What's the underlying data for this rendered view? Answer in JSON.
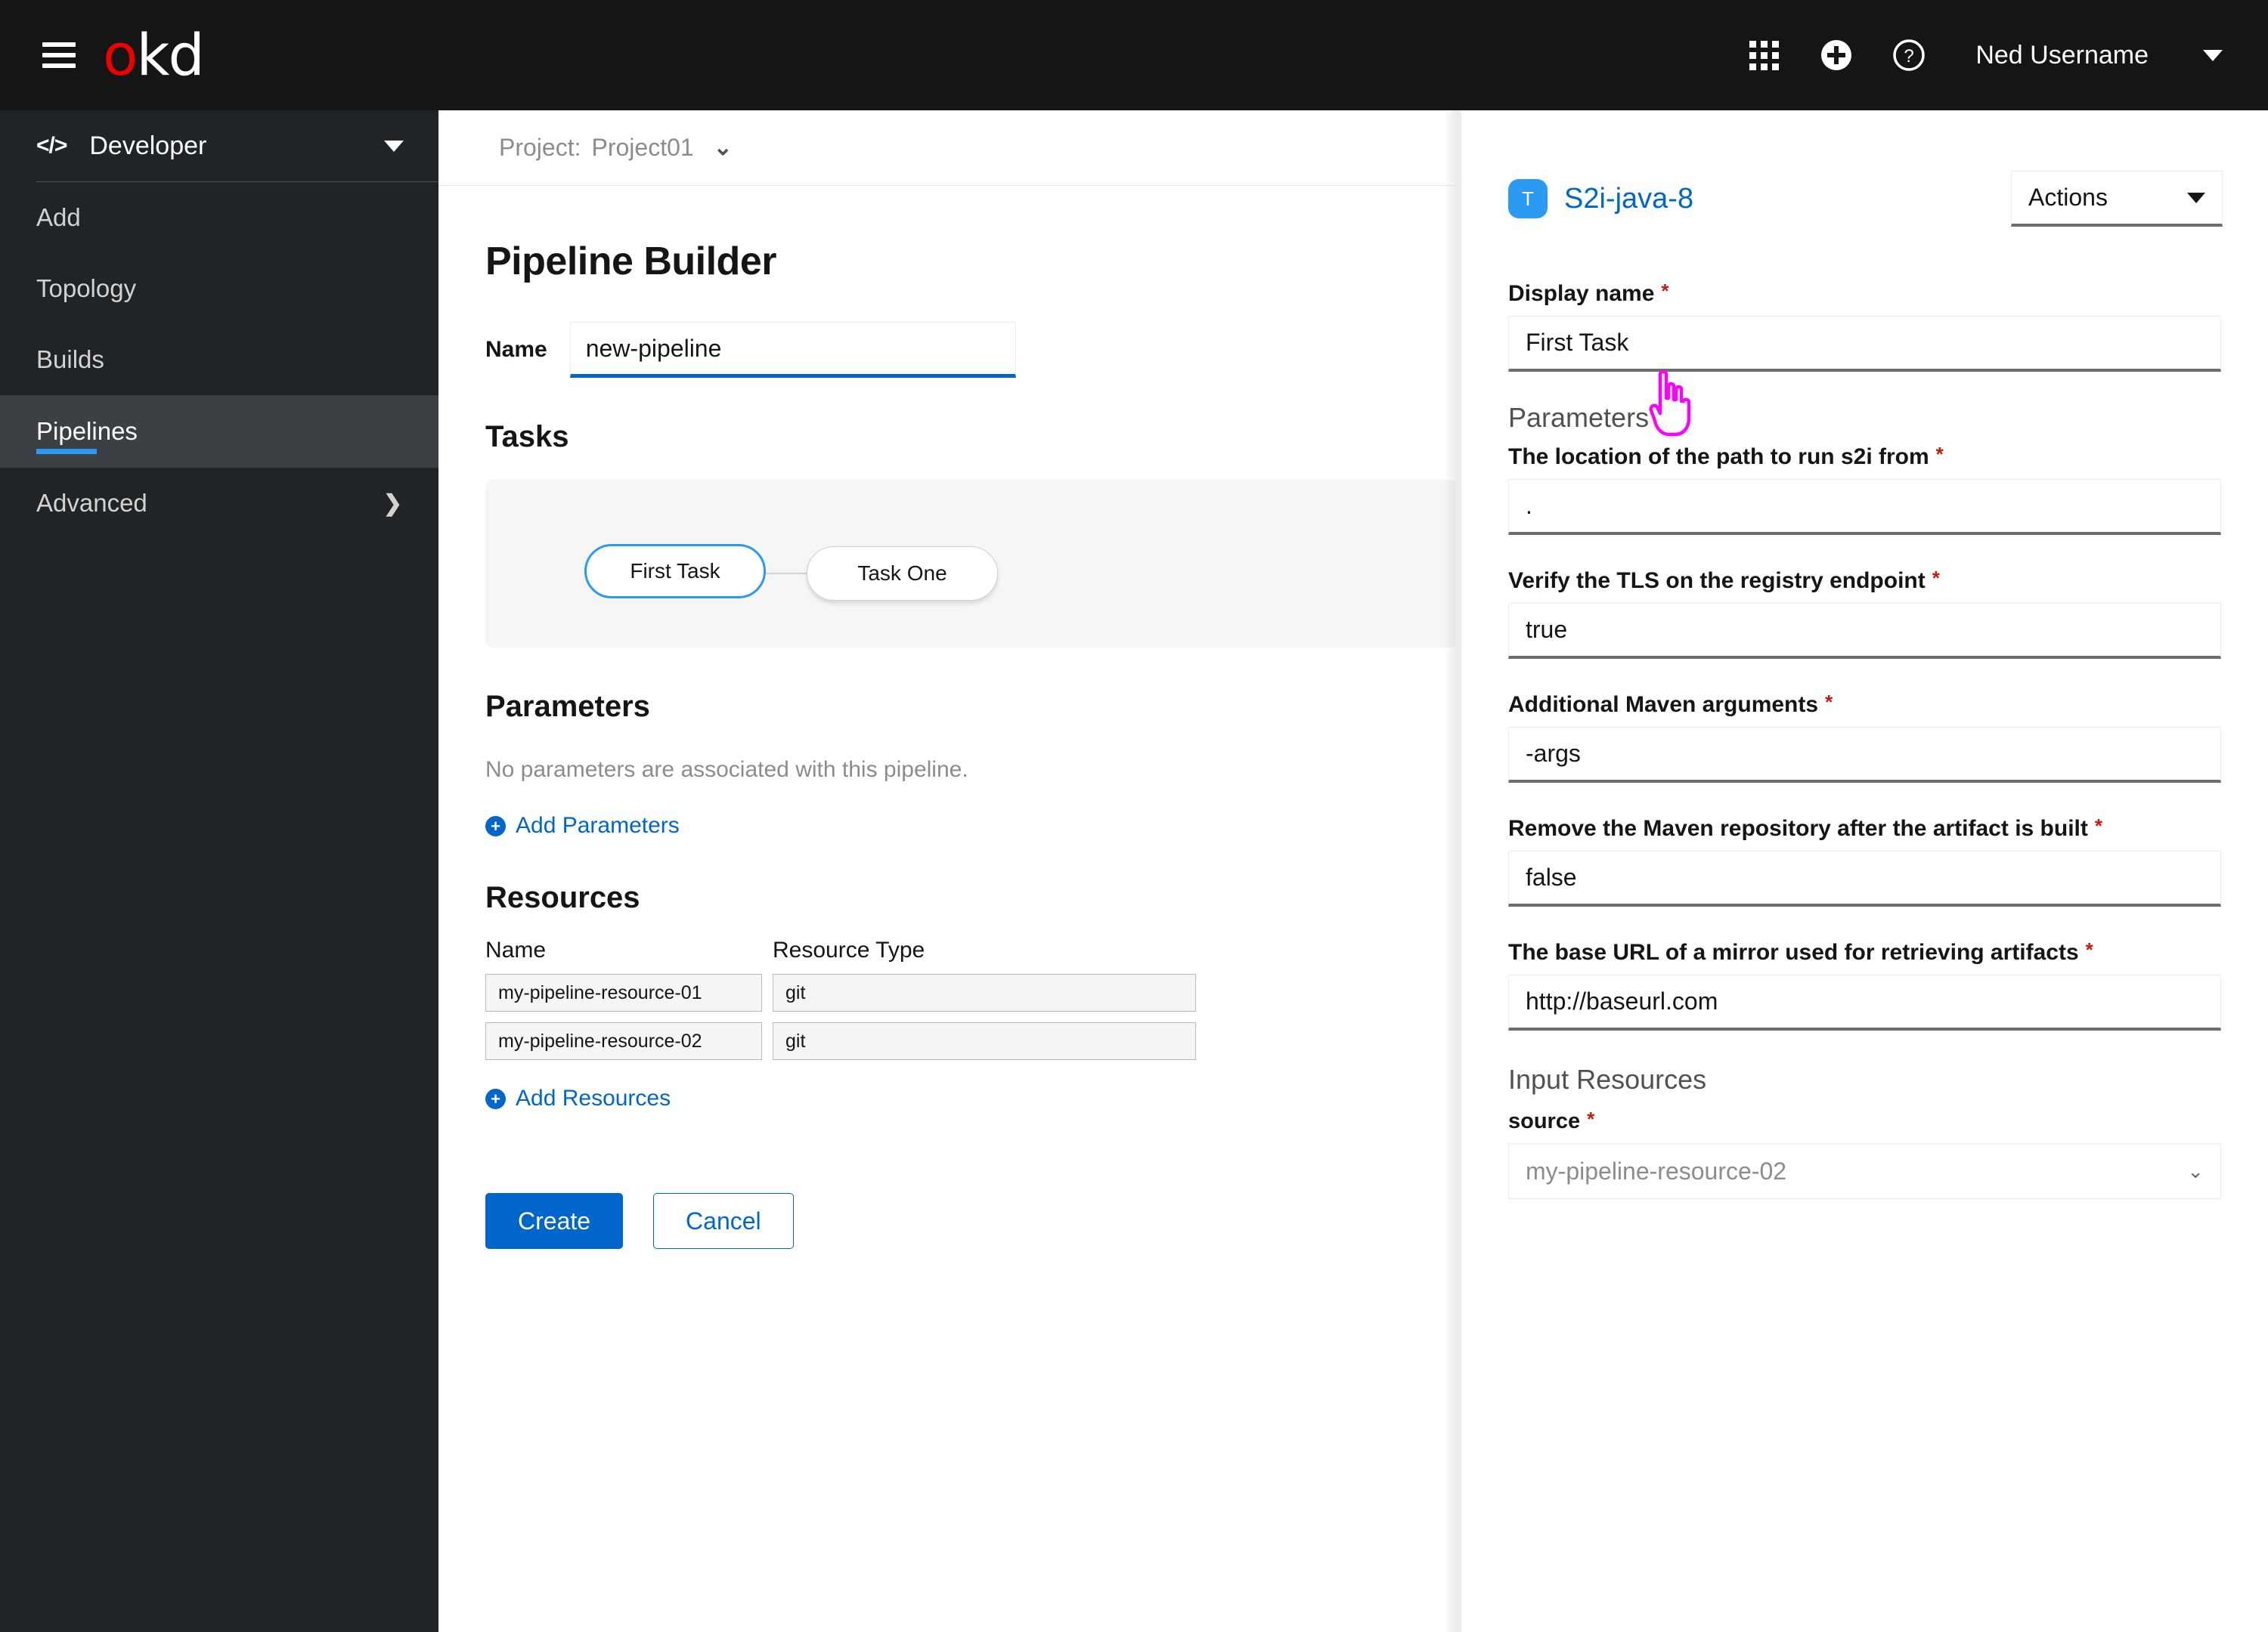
{
  "masthead": {
    "logo_o": "o",
    "logo_kd": "kd",
    "hamburger_icon": "hamburger-menu-icon",
    "apps_icon": "grid-apps-icon",
    "add_icon": "plus-circle-icon",
    "help_icon": "question-circle-icon",
    "username": "Ned Username",
    "user_caret_icon": "caret-down-icon"
  },
  "sidebar": {
    "perspective": {
      "label": "Developer",
      "icon": "code-brackets-icon",
      "caret": "caret-down-icon"
    },
    "items": [
      {
        "label": "Add",
        "active": false
      },
      {
        "label": "Topology",
        "active": false
      },
      {
        "label": "Builds",
        "active": false
      },
      {
        "label": "Pipelines",
        "active": true
      },
      {
        "label": "Advanced",
        "active": false,
        "chevron": "chevron-right-icon"
      }
    ]
  },
  "main": {
    "project_bar": {
      "label": "Project:",
      "value": "Project01",
      "chevron": "chevron-down-icon"
    },
    "page_title": "Pipeline Builder",
    "name_field": {
      "label": "Name",
      "value": "new-pipeline"
    },
    "tasks": {
      "heading": "Tasks",
      "nodes": [
        {
          "label": "First Task",
          "selected": true
        },
        {
          "label": "Task One",
          "selected": false
        }
      ]
    },
    "parameters": {
      "heading": "Parameters",
      "empty_text": "No parameters are associated with this pipeline.",
      "add_link": "Add Parameters"
    },
    "resources": {
      "heading": "Resources",
      "columns": [
        "Name",
        "Resource Type"
      ],
      "rows": [
        {
          "name": "my-pipeline-resource-01",
          "type": "git"
        },
        {
          "name": "my-pipeline-resource-02",
          "type": "git"
        }
      ],
      "add_link": "Add Resources"
    },
    "buttons": {
      "create": "Create",
      "cancel": "Cancel"
    }
  },
  "panel": {
    "badge": "T",
    "title": "S2i-java-8",
    "actions": {
      "label": "Actions",
      "caret": "caret-down-icon"
    },
    "display_name": {
      "label": "Display name",
      "value": "First Task",
      "required": "*"
    },
    "parameters_heading": "Parameters",
    "parameters": [
      {
        "label": "The location of the path to run s2i from",
        "value": ".",
        "required": "*"
      },
      {
        "label": "Verify the TLS on the registry endpoint",
        "value": "true",
        "required": "*"
      },
      {
        "label": "Additional Maven arguments",
        "value": "-args",
        "required": "*"
      },
      {
        "label": "Remove the Maven repository after the artifact is built",
        "value": "false",
        "required": "*"
      },
      {
        "label": "The base URL of a mirror used for retrieving artifacts",
        "value": "http://baseurl.com",
        "required": "*"
      }
    ],
    "input_resources_heading": "Input Resources",
    "source": {
      "label": "source",
      "value": "my-pipeline-resource-02",
      "required": "*",
      "chevron": "chevron-down-icon"
    }
  },
  "colors": {
    "masthead_bg": "#151515",
    "sidebar_bg": "#212427",
    "sidebar_active_bg": "#3c4044",
    "accent_blue": "#0066CC",
    "active_underline": "#2B9AF3",
    "required_red": "#C9190B",
    "logo_red": "#EE0000",
    "cursor_pink": "#FF00FF"
  },
  "cursor": {
    "icon": "pointing-hand-cursor"
  }
}
